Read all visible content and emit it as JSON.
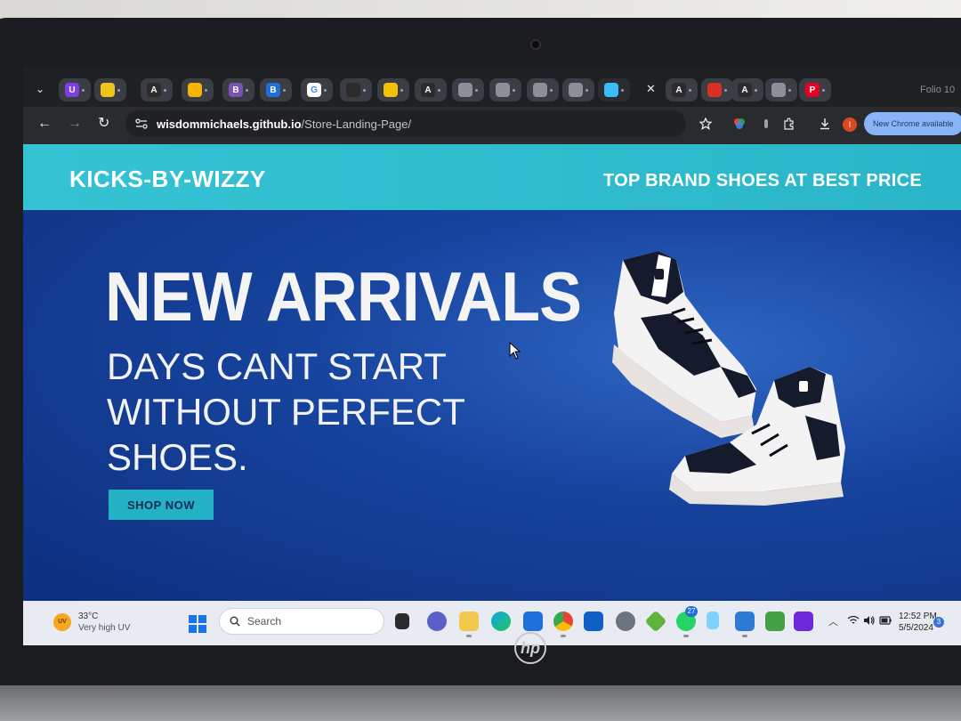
{
  "browser": {
    "window_title": "Folio 10",
    "tabs": [
      {
        "icon": "u-icon",
        "label": "U",
        "color": "#7b3fe4"
      },
      {
        "icon": "leaf-icon",
        "label": "",
        "color": "#f0c419"
      },
      {
        "icon": "angular-icon",
        "label": "A",
        "color": "#2b2b2b"
      },
      {
        "icon": "google-drive-icon",
        "label": "",
        "color": "#f4b400"
      },
      {
        "icon": "bootstrap-icon",
        "label": "B",
        "color": "#7952b3"
      },
      {
        "icon": "b-icon",
        "label": "B",
        "color": "#1e6fd9"
      },
      {
        "icon": "google-icon",
        "label": "G",
        "color": "#ffffff"
      },
      {
        "icon": "folder-icon",
        "label": "",
        "color": "#2b2b2b"
      },
      {
        "icon": "hat-icon",
        "label": "",
        "color": "#f2c200"
      },
      {
        "icon": "angular-icon",
        "label": "A",
        "color": "#2b2b2b"
      },
      {
        "icon": "globe-icon",
        "label": "",
        "color": "#8a8f98"
      },
      {
        "icon": "globe-icon",
        "label": "",
        "color": "#8a8f98"
      },
      {
        "icon": "globe-icon",
        "label": "",
        "color": "#8a8f98"
      },
      {
        "icon": "globe-icon",
        "label": "",
        "color": "#8a8f98"
      },
      {
        "icon": "tailwind-icon",
        "label": "",
        "color": "#38bdf8"
      },
      {
        "icon": "angular-icon",
        "label": "A",
        "color": "#2b2b2b"
      },
      {
        "icon": "red-circle-icon",
        "label": "",
        "color": "#d93025"
      },
      {
        "icon": "angular-icon",
        "label": "A",
        "color": "#2b2b2b"
      },
      {
        "icon": "globe-icon",
        "label": "",
        "color": "#8a8f98"
      },
      {
        "icon": "pinterest-icon",
        "label": "P",
        "color": "#e60023"
      }
    ],
    "new_tab_label": "+",
    "address": {
      "host": "wisdommichaels.github.io",
      "path": "/Store-Landing-Page/"
    },
    "update_button": "New Chrome available"
  },
  "page": {
    "brand": "KICKS-BY-WIZZY",
    "tagline": "TOP BRAND SHOES AT BEST PRICE",
    "hero_title": "NEW ARRIVALS",
    "hero_subtitle": "DAYS CANT START WITHOUT PERFECT SHOES.",
    "cta": "SHOP NOW"
  },
  "taskbar": {
    "weather_badge": "UV",
    "temperature": "33°C",
    "weather_desc": "Very high UV",
    "search_placeholder": "Search",
    "whatsapp_badge": "27",
    "time": "12:52 PM",
    "date": "5/5/2024",
    "notification_count": "3"
  },
  "colors": {
    "header_bg": "#2ab6c8",
    "hero_bg": "#17449e",
    "cta_bg": "#25b1c4"
  }
}
